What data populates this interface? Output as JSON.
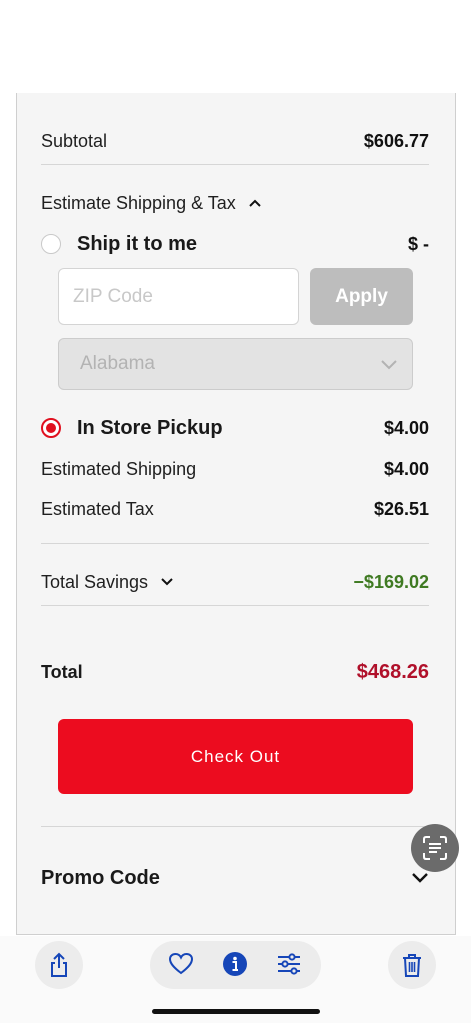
{
  "summary": {
    "subtotal_label": "Subtotal",
    "subtotal_value": "$606.77",
    "estimate_label": "Estimate Shipping & Tax",
    "ship_label": "Ship it to me",
    "ship_value": "$ -",
    "zip_placeholder": "ZIP Code",
    "apply_label": "Apply",
    "state_value": "Alabama",
    "pickup_label": "In Store Pickup",
    "pickup_value": "$4.00",
    "est_shipping_label": "Estimated Shipping",
    "est_shipping_value": "$4.00",
    "est_tax_label": "Estimated Tax",
    "est_tax_value": "$26.51",
    "savings_label": "Total Savings",
    "savings_value": "−$169.02",
    "total_label": "Total",
    "total_value": "$468.26",
    "checkout_label": "Check Out",
    "promo_label": "Promo Code"
  },
  "colors": {
    "accent_red": "#ec0c1f",
    "total_red": "#b0102a",
    "savings_green": "#3f7a22",
    "toolbar_icon_blue": "#1646b8"
  },
  "icons": {
    "estimate_toggle": "chevron-up-icon",
    "state_dropdown": "chevron-down-icon",
    "savings_toggle": "chevron-down-icon",
    "promo_toggle": "chevron-down-icon",
    "lens": "scan-text-icon",
    "share": "share-icon",
    "favorite": "heart-icon",
    "info": "info-icon",
    "adjust": "sliders-icon",
    "delete": "trash-icon"
  }
}
